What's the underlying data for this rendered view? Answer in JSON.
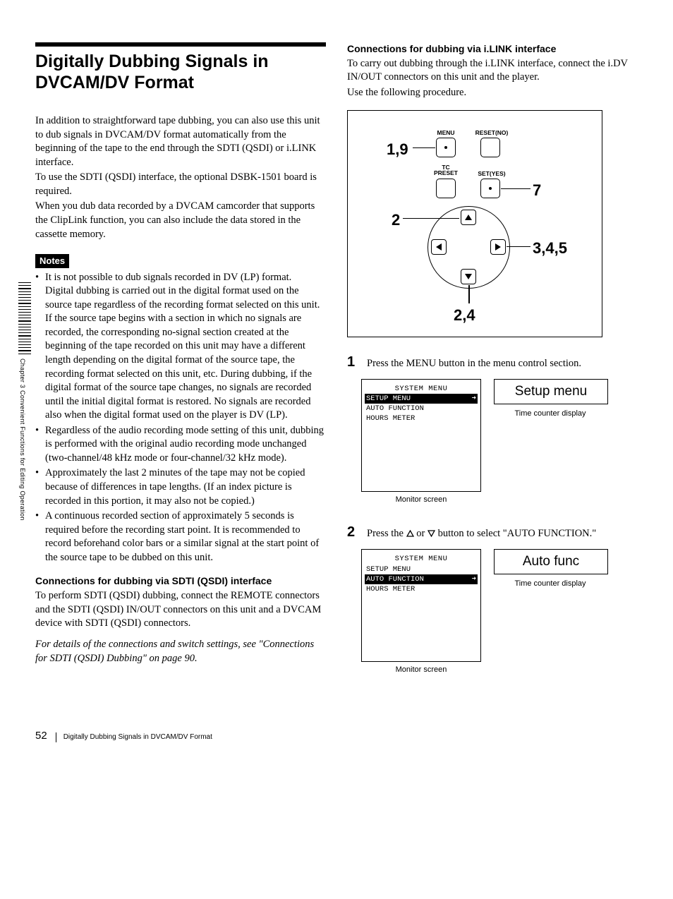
{
  "sidetab": "Chapter 3  Convenient Functions for Editing Operation",
  "left": {
    "title": "Digitally Dubbing Signals in DVCAM/DV Format",
    "intro1": "In addition to straightforward tape dubbing, you can also use this unit to dub signals in DVCAM/DV format automatically from the beginning of the tape to the end through the SDTI (QSDI) or i.LINK interface.",
    "intro2": "To use the SDTI (QSDI) interface, the optional DSBK-1501 board is required.",
    "intro3": "When you dub data recorded by a DVCAM camcorder that supports the ClipLink function, you can also include the data stored in the cassette memory.",
    "notes_label": "Notes",
    "notes": [
      "It is not possible to dub signals recorded in DV (LP) format.\nDigital dubbing is carried out in the digital format used on the source tape regardless of the recording format selected on this unit. If the source tape begins with a section in which no signals are recorded, the corresponding no-signal section created at the beginning of the tape recorded on this unit may have a different length depending on the digital format of the source tape, the recording format selected on this unit, etc. During dubbing, if the digital format of the source tape changes, no signals are recorded until the initial digital format is restored. No signals are recorded also when the digital format used on the player is DV (LP).",
      "Regardless of the audio recording mode setting of this unit, dubbing is performed with the original audio recording mode unchanged (two-channel/48 kHz mode or four-channel/32 kHz mode).",
      "Approximately the last 2 minutes of the tape may not be copied because of differences in tape lengths. (If an index picture is recorded in this portion, it may also not be copied.)",
      "A continuous recorded section of approximately 5 seconds is required before the recording start point. It is recommended to record beforehand color bars or a similar signal at the start point of the source tape to be dubbed on this unit."
    ],
    "sub1_head": "Connections for dubbing via SDTI (QSDI) interface",
    "sub1_body": "To perform SDTI (QSDI) dubbing, connect the REMOTE connectors and the SDTI (QSDI) IN/OUT connectors on this unit and a DVCAM device with SDTI (QSDI) connectors.",
    "sub1_ref": "For details of the connections and switch settings, see \"Connections for SDTI (QSDI) Dubbing\" on page 90."
  },
  "right": {
    "sub2_head": "Connections for dubbing via i.LINK interface",
    "sub2_body1": "To carry out dubbing through the i.LINK interface, connect the i.DV IN/OUT connectors on this unit and the player.",
    "sub2_body2": "Use the following procedure.",
    "diagram": {
      "labels": {
        "menu": "MENU",
        "resetno": "RESET(NO)",
        "tcpreset": "TC\nPRESET",
        "setyes": "SET(YES)"
      },
      "callouts": {
        "c1": "1,9",
        "c2": "7",
        "c3": "2",
        "c4": "3,4,5",
        "c5": "2,4"
      }
    },
    "step1_num": "1",
    "step1_txt": "Press the MENU button in the menu control section.",
    "screen1": {
      "title": "SYSTEM MENU",
      "rows": [
        {
          "text": "SETUP MENU",
          "sel": true,
          "arrow": true
        },
        {
          "text": "AUTO FUNCTION",
          "sel": false,
          "arrow": false
        },
        {
          "text": "HOURS METER",
          "sel": false,
          "arrow": false
        }
      ],
      "caption": "Monitor screen",
      "display": "Setup menu",
      "display_caption": "Time counter display"
    },
    "step2_num": "2",
    "step2_txt_a": "Press the ",
    "step2_txt_b": " or ",
    "step2_txt_c": " button to select \"AUTO FUNCTION.\"",
    "screen2": {
      "title": "SYSTEM MENU",
      "rows": [
        {
          "text": "SETUP MENU",
          "sel": false,
          "arrow": false
        },
        {
          "text": "AUTO FUNCTION",
          "sel": true,
          "arrow": true
        },
        {
          "text": "HOURS METER",
          "sel": false,
          "arrow": false
        }
      ],
      "caption": "Monitor screen",
      "display": "Auto func",
      "display_caption": "Time counter display"
    }
  },
  "footer": {
    "page": "52",
    "runhead": "Digitally Dubbing Signals in DVCAM/DV Format"
  }
}
